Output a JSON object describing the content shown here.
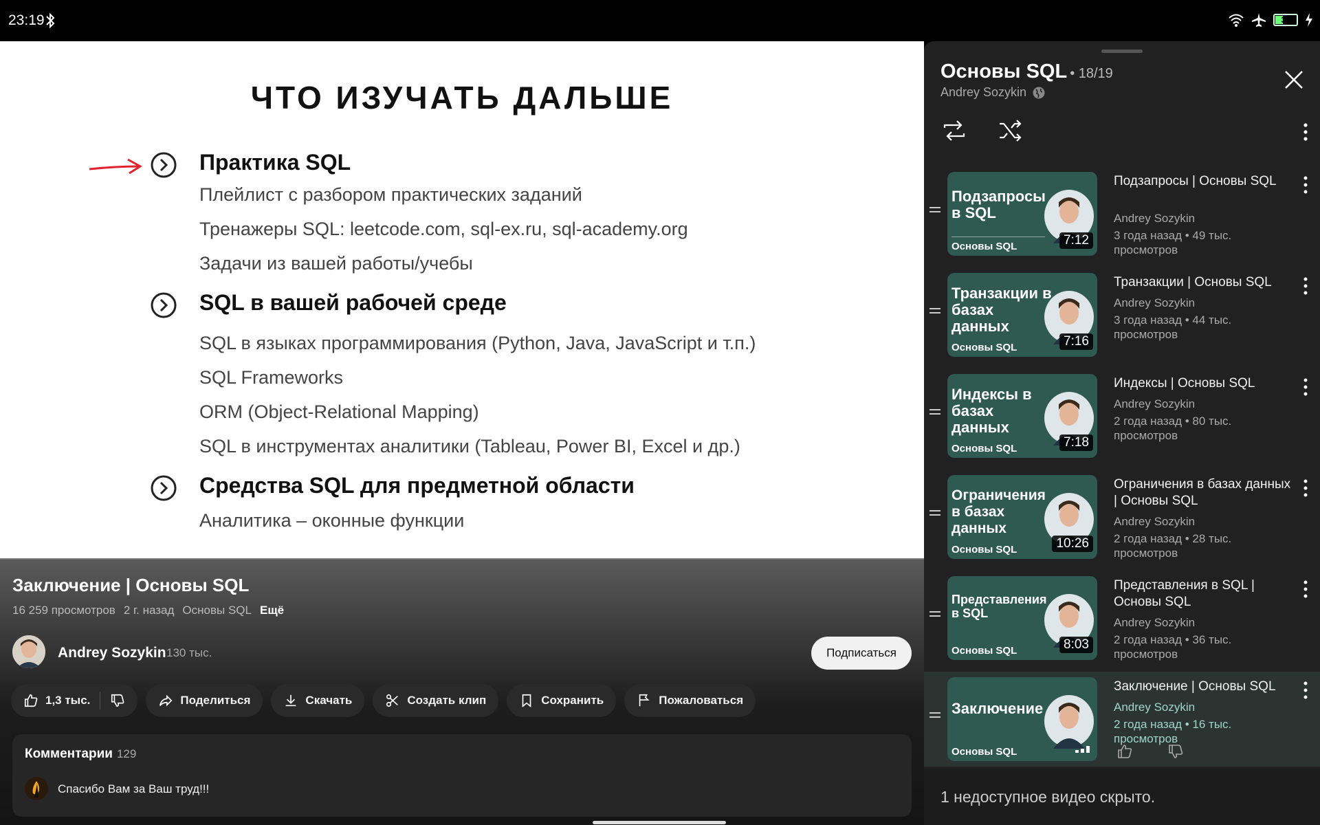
{
  "status_bar": {
    "time": "23:19",
    "battery": "34"
  },
  "slide": {
    "title": "ЧТО ИЗУЧАТЬ ДАЛЬШЕ",
    "sections": [
      {
        "heading": "Практика SQL",
        "bullets": [
          "Плейлист с разбором практических заданий",
          "Тренажеры SQL: leetcode.com, sql-ex.ru, sql-academy.org",
          "Задачи из вашей работы/учебы"
        ]
      },
      {
        "heading": "SQL в вашей рабочей среде",
        "bullets": [
          "SQL в языках программирования (Python, Java, JavaScript и т.п.)",
          "SQL Frameworks",
          "ORM (Object-Relational Mapping)",
          "SQL в инструментах аналитики (Tableau, Power BI, Excel и др.)"
        ]
      },
      {
        "heading": "Средства SQL для предметной области",
        "bullets": [
          "Аналитика – оконные функции"
        ]
      }
    ]
  },
  "video": {
    "title": "Заключение | Основы SQL",
    "views": "16 259 просмотров",
    "age": "2 г. назад",
    "playlist": "Основы SQL",
    "more": "Ещё",
    "channel": "Andrey Sozykin",
    "subscribers": "130 тыс.",
    "subscribe_label": "Подписаться",
    "actions": {
      "likes": "1,3 тыс.",
      "share": "Поделиться",
      "download": "Скачать",
      "clip": "Создать клип",
      "save": "Сохранить",
      "report": "Пожаловаться"
    },
    "comments": {
      "label": "Комментарии",
      "count": "129",
      "first": "Спасибо Вам за Ваш труд!!!"
    }
  },
  "playlist": {
    "title": "Основы SQL",
    "position": "• 18/19",
    "owner": "Andrey Sozykin",
    "hidden_note": "1 недоступное видео скрыто.",
    "items": [
      {
        "thumb_text": "Подзапросы в SQL",
        "thumb_sub": "Основы SQL",
        "duration": "7:12",
        "title": "Подзапросы | Основы SQL",
        "channel": "Andrey Sozykin",
        "meta": "3 года назад • 49 тыс. просмотров"
      },
      {
        "thumb_text": "Транзакции в базах данных",
        "thumb_sub": "Основы SQL",
        "duration": "7:16",
        "title": "Транзакции | Основы SQL",
        "channel": "Andrey Sozykin",
        "meta": "3 года назад • 44 тыс. просмотров"
      },
      {
        "thumb_text": "Индексы в базах данных",
        "thumb_sub": "Основы SQL",
        "duration": "7:18",
        "title": "Индексы | Основы SQL",
        "channel": "Andrey Sozykin",
        "meta": "2 года назад • 80 тыс. просмотров"
      },
      {
        "thumb_text": "Ограничения в базах данных",
        "thumb_sub": "Основы SQL",
        "duration": "10:26",
        "title": "Ограничения в базах данных | Основы SQL",
        "channel": "Andrey Sozykin",
        "meta": "2 года назад • 28 тыс. просмотров"
      },
      {
        "thumb_text": "Представления в SQL",
        "thumb_sub": "Основы SQL",
        "duration": "8:03",
        "title": "Представления в SQL | Основы SQL",
        "channel": "Andrey Sozykin",
        "meta": "2 года назад • 36 тыс. просмотров"
      },
      {
        "thumb_text": "Заключение",
        "thumb_sub": "Основы SQL",
        "duration": "",
        "title": "Заключение | Основы SQL",
        "channel": "Andrey Sozykin",
        "meta": "2 года назад • 16 тыс. просмотров"
      }
    ]
  },
  "colors": {
    "accent_red": "#e0222e",
    "thumb_bg": "#2f5a51",
    "panel_bg": "#212121"
  }
}
